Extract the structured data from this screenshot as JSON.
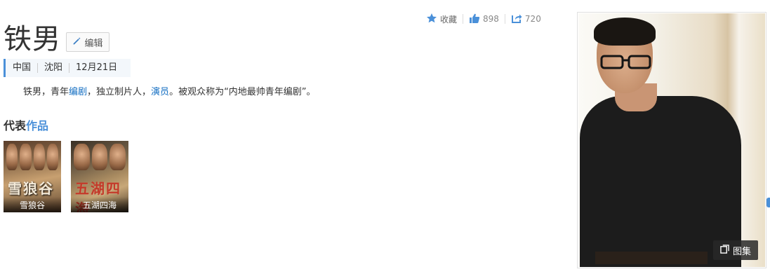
{
  "header": {
    "title": "铁男",
    "edit_label": "编辑"
  },
  "actions": {
    "favorite_label": "收藏",
    "like_count": "898",
    "share_count": "720"
  },
  "tags": [
    "中国",
    "沈阳",
    "12月21日"
  ],
  "summary": {
    "part1": "铁男，青年",
    "link1": "编剧",
    "part2": "，独立制片人，",
    "link2": "演员",
    "part3": "。被观众称为“内地最帅青年编剧”。"
  },
  "works_section": {
    "title_prefix": "代表",
    "title_accent": "作品",
    "items": [
      {
        "caption": "雪狼谷",
        "poster_text": "雪狼谷"
      },
      {
        "caption": "五湖四海",
        "poster_text": "五湖四海"
      }
    ]
  },
  "gallery": {
    "button_label": "图集"
  },
  "colors": {
    "accent": "#4a90d9",
    "link": "#136ec2",
    "text": "#333333"
  },
  "icons": [
    "pencil-icon",
    "star-icon",
    "thumbs-up-icon",
    "share-icon",
    "gallery-icon"
  ]
}
